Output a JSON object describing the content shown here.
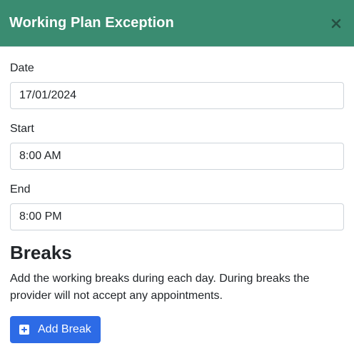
{
  "modal": {
    "title": "Working Plan Exception",
    "close_icon": "close-icon",
    "header_color": "#3a8c71"
  },
  "fields": {
    "date": {
      "label": "Date",
      "value": "17/01/2024"
    },
    "start": {
      "label": "Start",
      "value": "8:00 AM"
    },
    "end": {
      "label": "End",
      "value": "8:00 PM"
    }
  },
  "breaks": {
    "heading": "Breaks",
    "description": "Add the working breaks during each day. During breaks the provider will not accept any appointments.",
    "add_button": {
      "label": "Add Break",
      "icon": "plus-square-icon",
      "color": "#2d6be6"
    }
  }
}
